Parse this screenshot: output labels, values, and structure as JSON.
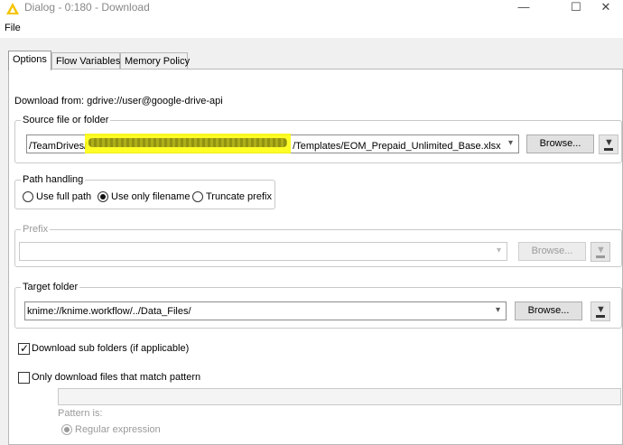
{
  "window": {
    "title": "Dialog - 0:180 - Download",
    "minimize_glyph": "—",
    "maximize_glyph": "☐",
    "close_glyph": "✕"
  },
  "menu": {
    "file": "File"
  },
  "tabs": [
    {
      "label": "Options",
      "active": true
    },
    {
      "label": "Flow Variables",
      "active": false
    },
    {
      "label": "Memory Policy",
      "active": false
    }
  ],
  "download_from": "Download from: gdrive://user@google-drive-api",
  "source": {
    "title": "Source file or folder",
    "value_prefix": "/TeamDrives/",
    "value_suffix": "/Templates/EOM_Prepaid_Unlimited_Base.xlsx",
    "browse_label": "Browse..."
  },
  "path_handling": {
    "title": "Path handling",
    "options": [
      "Use full path",
      "Use only filename",
      "Truncate prefix"
    ],
    "selected": "Use only filename"
  },
  "prefix": {
    "title": "Prefix",
    "value": "",
    "browse_label": "Browse..."
  },
  "target": {
    "title": "Target folder",
    "value": "knime://knime.workflow/../Data_Files/",
    "browse_label": "Browse..."
  },
  "download_sub_folders": {
    "label": "Download sub folders (if applicable)",
    "checked": true
  },
  "only_matching": {
    "label": "Only download files that match pattern",
    "checked": false
  },
  "pattern": {
    "value": "",
    "label": "Pattern is:",
    "regex_label": "Regular expression"
  },
  "icons": {
    "app": "knime-warning-triangle-icon",
    "dropdown": "chevron-down-icon",
    "flow_variable": "flow-variable-icon"
  }
}
